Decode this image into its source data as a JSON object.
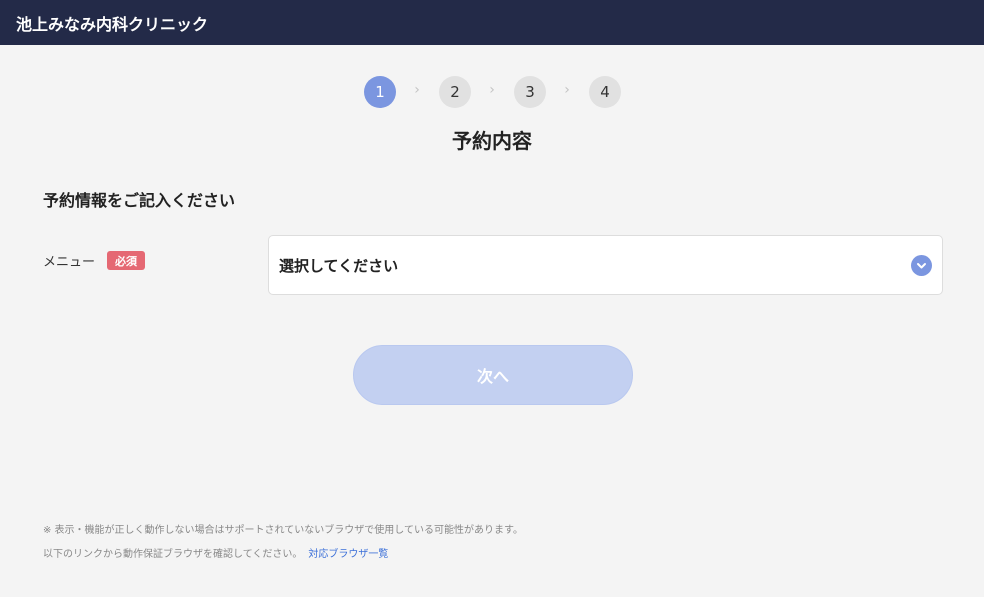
{
  "header": {
    "title": "池上みなみ内科クリニック"
  },
  "steps": [
    {
      "number": "1",
      "active": true
    },
    {
      "number": "2",
      "active": false
    },
    {
      "number": "3",
      "active": false
    },
    {
      "number": "4",
      "active": false
    }
  ],
  "page_title": "予約内容",
  "form": {
    "section_title": "予約情報をご記入ください",
    "menu_label": "メニュー",
    "required_badge": "必須",
    "menu_select_value": "選択してください",
    "next_button": "次へ"
  },
  "footer": {
    "note_line1": "※ 表示・機能が正しく動作しない場合はサポートされていないブラウザで使用している可能性があります。",
    "note_line2": "以下のリンクから動作保証ブラウザを確認してください。",
    "link_text": "対応ブラウザ一覧"
  },
  "colors": {
    "header_bg": "#232a48",
    "accent": "#7b96e0",
    "required": "#e56873",
    "button_disabled": "#c3d0f1",
    "link": "#3b6fd8"
  }
}
